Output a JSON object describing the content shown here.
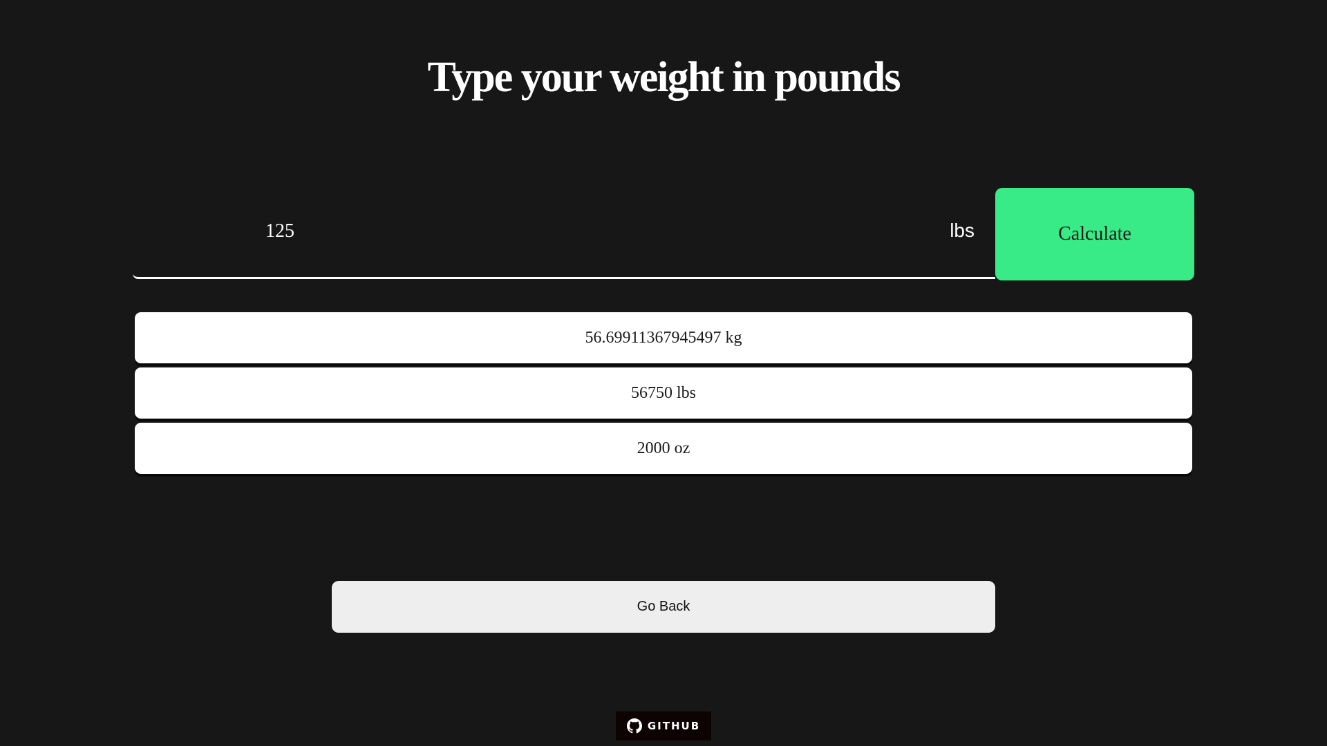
{
  "page": {
    "title": "Type your weight in pounds"
  },
  "form": {
    "weight_value": "125",
    "unit_label": "lbs",
    "calculate_label": "Calculate"
  },
  "results": [
    {
      "text": "56.69911367945497 kg"
    },
    {
      "text": "56750 lbs"
    },
    {
      "text": "2000 oz"
    }
  ],
  "navigation": {
    "go_back_label": "Go Back"
  },
  "footer": {
    "github_label": "GITHUB",
    "github_icon": "github-icon"
  },
  "colors": {
    "background": "#171717",
    "accent": "#38eb86",
    "card": "#ffffff",
    "button": "#eeeeee"
  }
}
